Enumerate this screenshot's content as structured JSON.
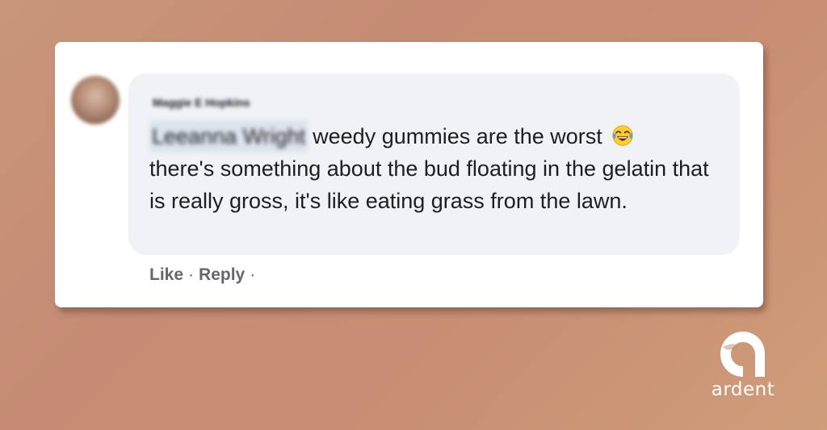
{
  "comment": {
    "author_name": "Maggie E Hopkins",
    "mention": "Leeanna Wright",
    "text_line1": "weedy gummies are the worst",
    "text_rest": "there's something about the bud floating in the gelatin that is really gross, it's like eating grass from the lawn.",
    "emoji": "face-with-tears-of-joy",
    "actions": {
      "like_label": "Like",
      "separator": "·",
      "reply_label": "Reply"
    }
  },
  "brand": {
    "name": "ardent",
    "logo_icon": "ardent-logo-icon"
  },
  "colors": {
    "background": "#c8907a",
    "card": "#ffffff",
    "bubble": "#f0f2f5",
    "text": "#1c1e21",
    "action_text": "#65676b",
    "brand": "#ffffff"
  }
}
